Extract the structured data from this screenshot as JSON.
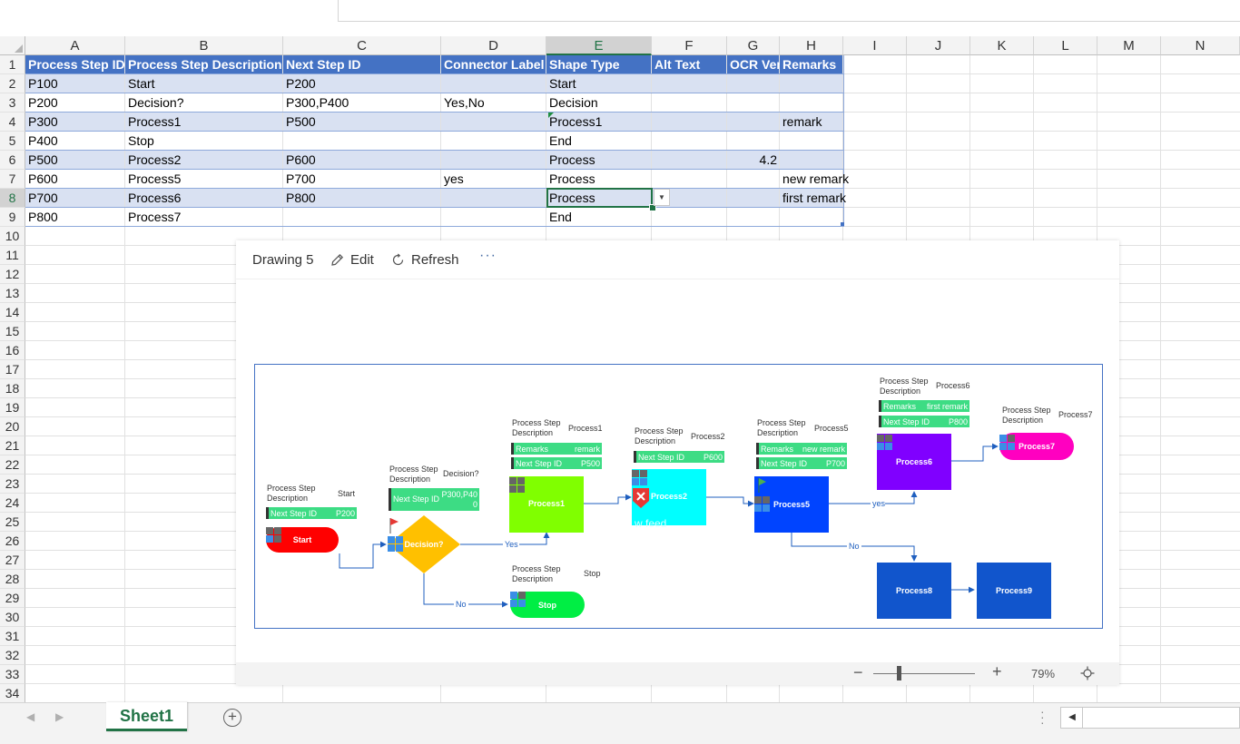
{
  "columns": [
    "A",
    "B",
    "C",
    "D",
    "E",
    "F",
    "G",
    "H",
    "I",
    "J",
    "K",
    "L",
    "M",
    "N"
  ],
  "rows": [
    "1",
    "2",
    "3",
    "4",
    "5",
    "6",
    "7",
    "8",
    "9",
    "10",
    "11",
    "12",
    "13",
    "14",
    "15",
    "16",
    "17",
    "18",
    "19",
    "20",
    "21",
    "22",
    "23",
    "24",
    "25",
    "26",
    "27",
    "28",
    "29",
    "30",
    "31",
    "32",
    "33",
    "34"
  ],
  "active_column": "E",
  "active_row": "8",
  "table": {
    "headers": [
      "Process Step ID",
      "Process Step Description",
      "Next Step ID",
      "Connector Label",
      "Shape Type",
      "Alt Text",
      "OCR Ver",
      "Remarks"
    ],
    "rows": [
      [
        "P100",
        "Start",
        "P200",
        "",
        "Start",
        "",
        "",
        ""
      ],
      [
        "P200",
        "Decision?",
        "P300,P400",
        "Yes,No",
        "Decision",
        "",
        "",
        ""
      ],
      [
        "P300",
        "Process1",
        "P500",
        "",
        "Process1",
        "",
        "",
        "remark"
      ],
      [
        "P400",
        "Stop",
        "",
        "",
        "End",
        "",
        "",
        ""
      ],
      [
        "P500",
        "Process2",
        "P600",
        "",
        "Process",
        "",
        "4.2",
        ""
      ],
      [
        "P600",
        "Process5",
        "P700",
        "yes",
        "Process",
        "",
        "",
        "new remark"
      ],
      [
        "P700",
        "Process6",
        "P800",
        "",
        "Process",
        "",
        "",
        "first remark"
      ],
      [
        "P800",
        "Process7",
        "",
        "",
        "End",
        "",
        "",
        ""
      ]
    ]
  },
  "drawing": {
    "title": "Drawing 5",
    "edit_label": "Edit",
    "refresh_label": "Refresh",
    "more_label": "···",
    "zoom": {
      "minus": "−",
      "plus": "+",
      "value": "79%",
      "level": 0.79
    },
    "labels": {
      "psd": "Process Step",
      "psd2": "Description",
      "next_step_id": "Next Step ID",
      "remarks": "Remarks"
    },
    "shapes": {
      "start": {
        "text": "Start",
        "header": "Start",
        "next": "P200",
        "color": "#ff0000"
      },
      "decision": {
        "text": "Decision?",
        "header": "Decision?",
        "next": "P300,P40",
        "next2": "0",
        "color": "#ffc000"
      },
      "stop": {
        "text": "Stop",
        "header": "Stop",
        "color": "#00ee44"
      },
      "process1": {
        "text": "Process1",
        "header": "Process1",
        "remarks": "remark",
        "next": "P500",
        "color": "#80ff00"
      },
      "process2": {
        "text": "Process2",
        "header": "Process2",
        "next": "P600",
        "overlay": "w feed",
        "color": "#00ffff"
      },
      "process5": {
        "text": "Process5",
        "header": "Process5",
        "remarks": "new remark",
        "next": "P700",
        "color": "#0044ff"
      },
      "process6": {
        "text": "Process6",
        "header": "Process6",
        "remarks": "first remark",
        "next": "P800",
        "color": "#8000ff"
      },
      "process7": {
        "text": "Process7",
        "header": "Process7",
        "color": "#ff00c0"
      },
      "process8": {
        "text": "Process8",
        "color": "#1155cc"
      },
      "process9": {
        "text": "Process9",
        "color": "#1155cc"
      }
    },
    "connectors": {
      "yes": "Yes",
      "no": "No",
      "yes_lower": "yes",
      "no2": "No"
    }
  },
  "sheet_tab": "Sheet1",
  "add_sheet": "+",
  "colors": {
    "accent": "#217346",
    "table_header": "#4472c4",
    "table_band": "#d9e1f2",
    "panel_bg": "#3ddc84"
  }
}
